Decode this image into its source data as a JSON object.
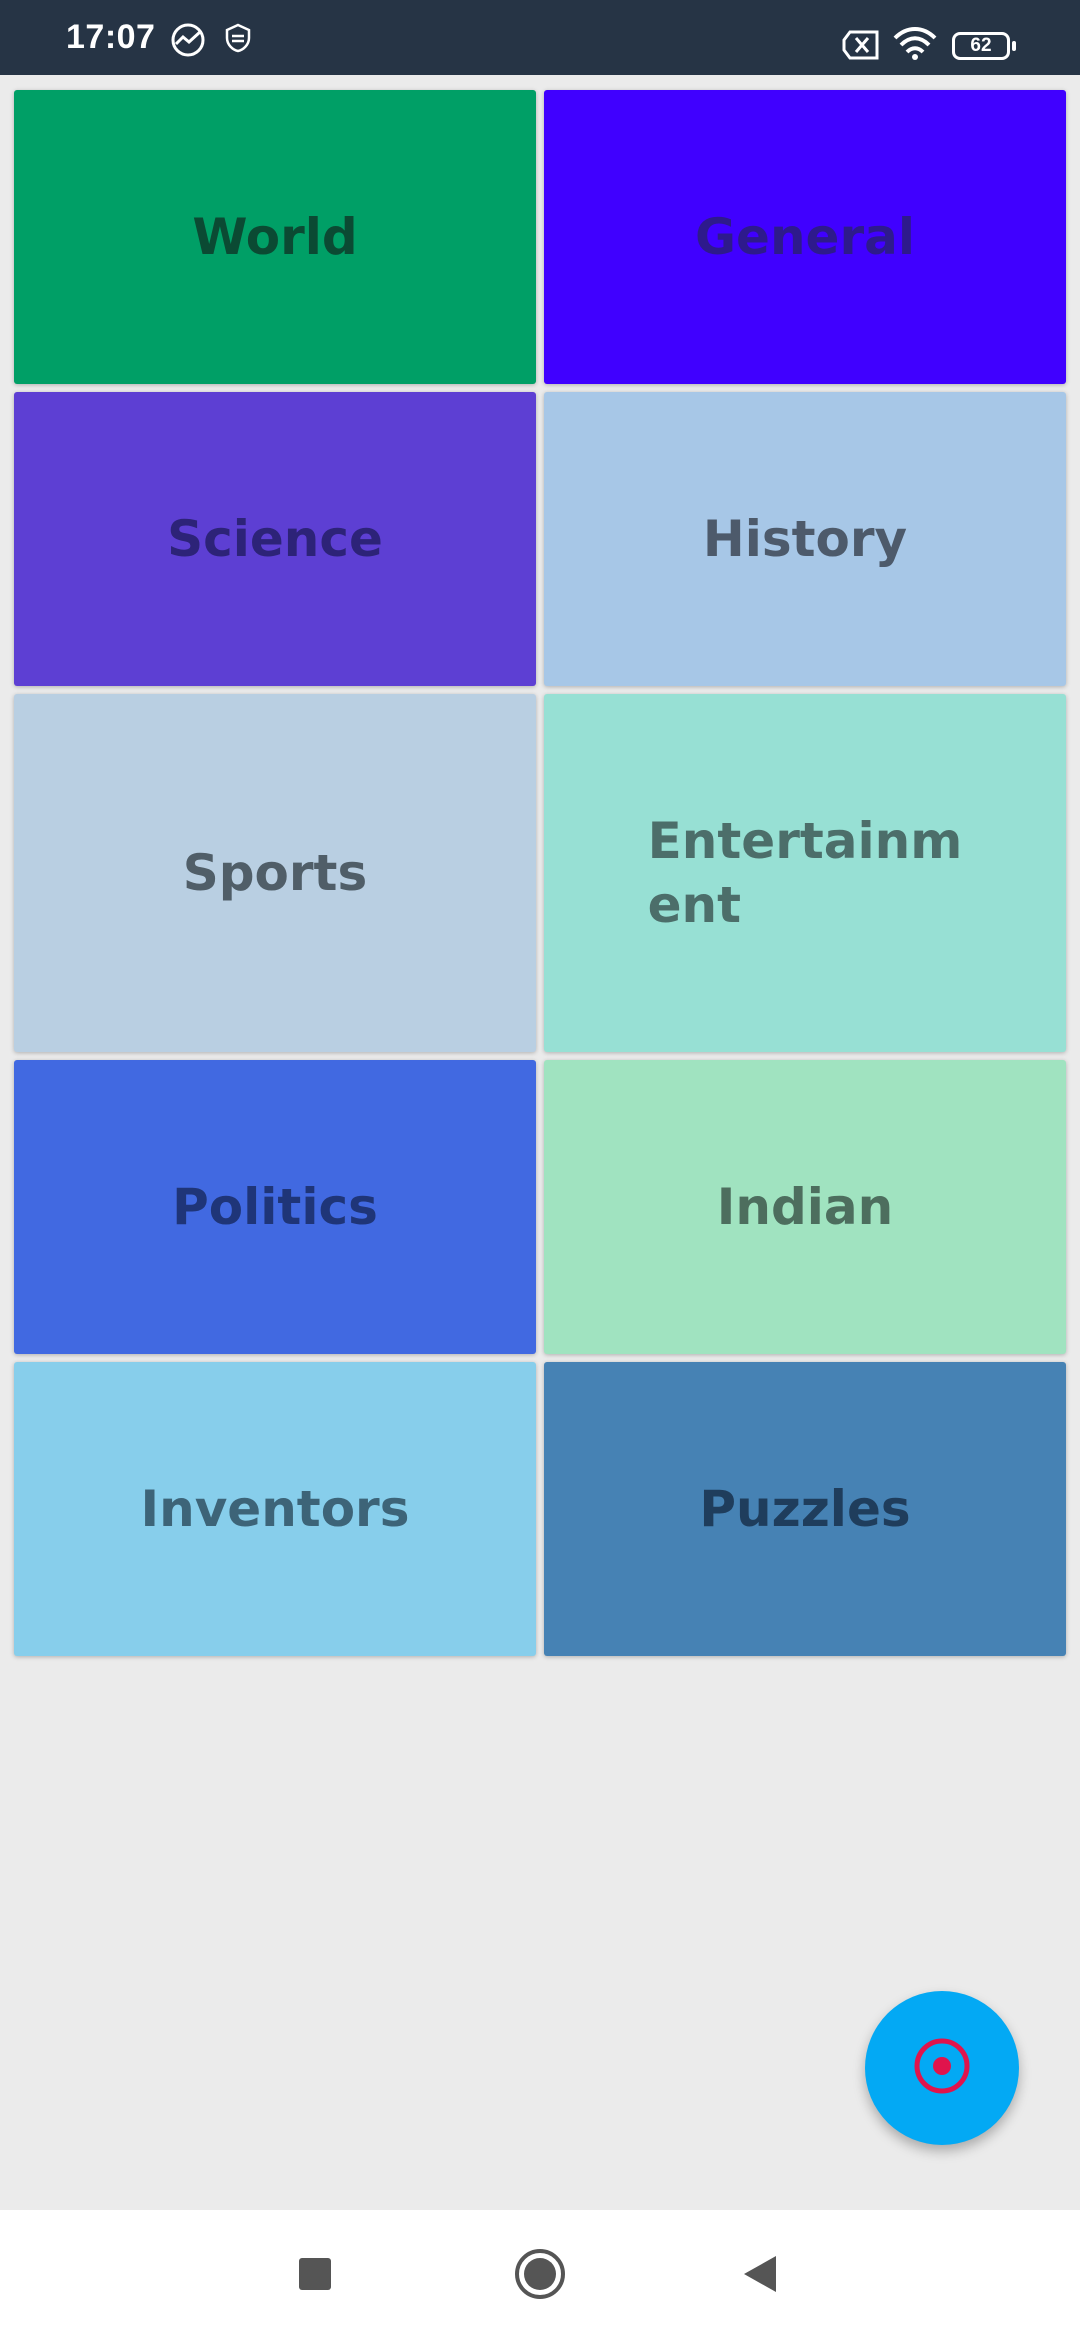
{
  "status_bar": {
    "time": "17:07",
    "icons": [
      "chart-circle-icon",
      "shield-sync-icon",
      "sim-off-icon",
      "wifi-icon",
      "battery-icon"
    ],
    "battery_level": "62"
  },
  "categories": [
    {
      "label": "World",
      "color": "#009f66",
      "text_color": "#0b4a33"
    },
    {
      "label": "General",
      "color": "#4000ff",
      "text_color": "#2e1a8c"
    },
    {
      "label": "Science",
      "color": "#5d3fd3",
      "text_color": "#2d2378"
    },
    {
      "label": "History",
      "color": "#a7c7e7",
      "text_color": "#4d5a6b"
    },
    {
      "label": "Sports",
      "color": "#b9cfe2",
      "text_color": "#505e68"
    },
    {
      "label": "Entertainm\nent",
      "color": "#97e0d4",
      "text_color": "#4c6e6a"
    },
    {
      "label": "Politics",
      "color": "#4169e1",
      "text_color": "#1f3578"
    },
    {
      "label": "Indian",
      "color": "#a0e3c0",
      "text_color": "#4d6e5e"
    },
    {
      "label": "Inventors",
      "color": "#87ceeb",
      "text_color": "#3d6478"
    },
    {
      "label": "Puzzles",
      "color": "#4682b4",
      "text_color": "#1f3d5c"
    }
  ],
  "fab": {
    "icon": "target-icon",
    "color": "#03a9f4",
    "icon_color": "#e0144c"
  },
  "nav_bar": {
    "icons": [
      "recents-square-icon",
      "home-circle-icon",
      "back-triangle-icon"
    ]
  }
}
